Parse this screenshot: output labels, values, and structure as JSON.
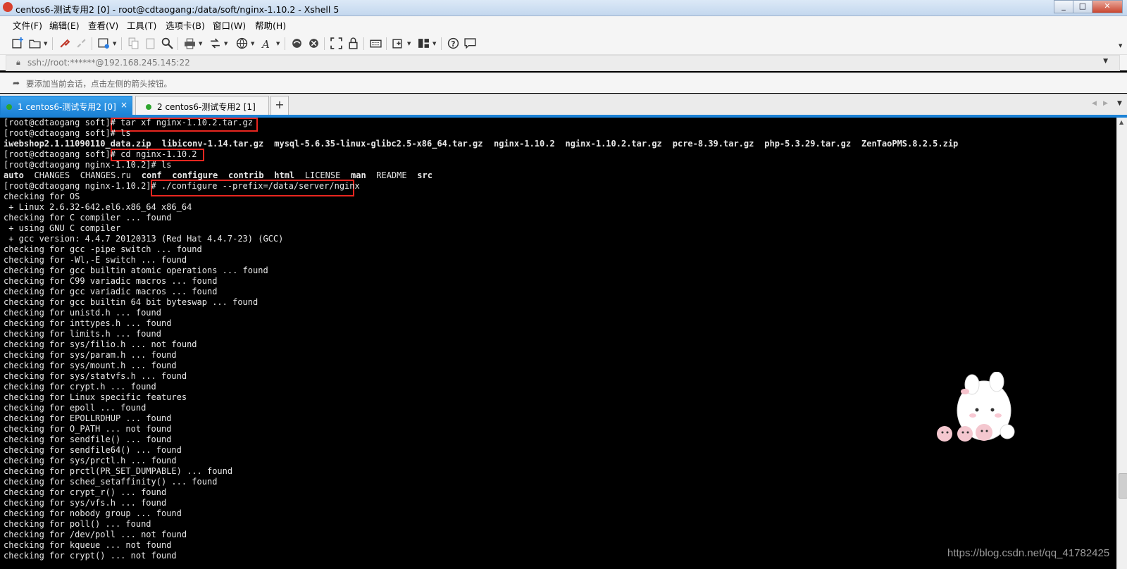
{
  "window": {
    "title": "centos6-测试专用2 [0] - root@cdtaogang:/data/soft/nginx-1.10.2 - Xshell 5"
  },
  "menu": [
    "文件(F)",
    "编辑(E)",
    "查看(V)",
    "工具(T)",
    "选项卡(B)",
    "窗口(W)",
    "帮助(H)"
  ],
  "toolbar": {
    "icons": [
      "new-session-icon",
      "open-folder-icon",
      "reconnect-icon",
      "disconnect-icon",
      "properties-icon",
      "copy-icon",
      "paste-icon",
      "find-icon",
      "print-icon",
      "transfer-icon",
      "globe-icon",
      "font-icon",
      "xftp-icon",
      "xmanager-icon",
      "fullscreen-icon",
      "lock-icon",
      "keyboard-icon",
      "compose-icon",
      "layout-icon",
      "help-icon",
      "chat-icon"
    ]
  },
  "address": {
    "value": "ssh://root:******@192.168.245.145:22"
  },
  "hint": {
    "text": "要添加当前会话，点击左侧的箭头按钮。"
  },
  "tabs": [
    {
      "label": "1 centos6-测试专用2 [0]",
      "active": true,
      "status_color": "#2da52d"
    },
    {
      "label": "2 centos6-测试专用2 [1]",
      "active": false,
      "status_color": "#2da52d"
    }
  ],
  "terminal": {
    "lines": [
      "[root@cdtaogang soft]# tar xf nginx-1.10.2.tar.gz",
      "[root@cdtaogang soft]# ls",
      "",
      "[root@cdtaogang soft]# cd nginx-1.10.2",
      "[root@cdtaogang nginx-1.10.2]# ls",
      "",
      "[root@cdtaogang nginx-1.10.2]# ./configure --prefix=/data/server/nginx",
      "checking for OS",
      " + Linux 2.6.32-642.el6.x86_64 x86_64",
      "checking for C compiler ... found",
      " + using GNU C compiler",
      " + gcc version: 4.4.7 20120313 (Red Hat 4.4.7-23) (GCC)",
      "checking for gcc -pipe switch ... found",
      "checking for -Wl,-E switch ... found",
      "checking for gcc builtin atomic operations ... found",
      "checking for C99 variadic macros ... found",
      "checking for gcc variadic macros ... found",
      "checking for gcc builtin 64 bit byteswap ... found",
      "checking for unistd.h ... found",
      "checking for inttypes.h ... found",
      "checking for limits.h ... found",
      "checking for sys/filio.h ... not found",
      "checking for sys/param.h ... found",
      "checking for sys/mount.h ... found",
      "checking for sys/statvfs.h ... found",
      "checking for crypt.h ... found",
      "checking for Linux specific features",
      "checking for epoll ... found",
      "checking for EPOLLRDHUP ... found",
      "checking for O_PATH ... not found",
      "checking for sendfile() ... found",
      "checking for sendfile64() ... found",
      "checking for sys/prctl.h ... found",
      "checking for prctl(PR_SET_DUMPABLE) ... found",
      "checking for sched_setaffinity() ... found",
      "checking for crypt_r() ... found",
      "checking for sys/vfs.h ... found",
      "checking for nobody group ... found",
      "checking for poll() ... found",
      "checking for /dev/poll ... not found",
      "checking for kqueue ... not found",
      "checking for crypt() ... not found"
    ],
    "ls_soft": [
      "iwebshop2.1.11090110_data.zip",
      "libiconv-1.14.tar.gz",
      "mysql-5.6.35-linux-glibc2.5-x86_64.tar.gz",
      "nginx-1.10.2",
      "nginx-1.10.2.tar.gz",
      "pcre-8.39.tar.gz",
      "php-5.3.29.tar.gz",
      "ZenTaoPMS.8.2.5.zip"
    ],
    "ls_nginx": [
      {
        "name": "auto",
        "bold": true
      },
      {
        "name": "CHANGES",
        "bold": false
      },
      {
        "name": "CHANGES.ru",
        "bold": false
      },
      {
        "name": "conf",
        "bold": true
      },
      {
        "name": "configure",
        "bold": true
      },
      {
        "name": "contrib",
        "bold": true
      },
      {
        "name": "html",
        "bold": true
      },
      {
        "name": "LICENSE",
        "bold": false
      },
      {
        "name": "man",
        "bold": true
      },
      {
        "name": "README",
        "bold": false
      },
      {
        "name": "src",
        "bold": true
      }
    ],
    "highlights": [
      {
        "text": "tar xf nginx-1.10.2.tar.gz"
      },
      {
        "text": "cd nginx-1.10.2"
      },
      {
        "text": "./configure --prefix=/data/server/nginx"
      }
    ],
    "highlight_color": "#e8261f"
  },
  "watermark": "https://blog.csdn.net/qq_41782425"
}
